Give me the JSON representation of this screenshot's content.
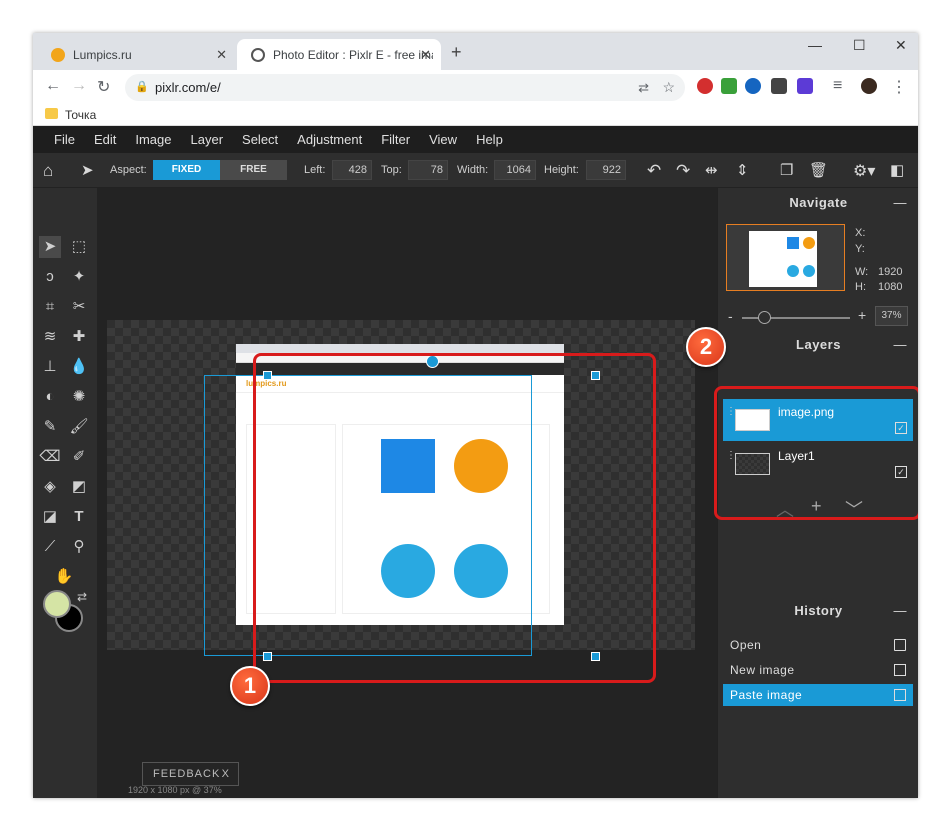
{
  "browser": {
    "tabs": [
      {
        "title": "Lumpics.ru"
      },
      {
        "title": "Photo Editor : Pixlr E - free image"
      }
    ],
    "url": "pixlr.com/e/",
    "bookmark": "Точка"
  },
  "menu": [
    "File",
    "Edit",
    "Image",
    "Layer",
    "Select",
    "Adjustment",
    "Filter",
    "View",
    "Help"
  ],
  "toolbar": {
    "aspect_label": "Aspect:",
    "fixed_label": "FIXED",
    "free_label": "FREE",
    "left_label": "Left:",
    "left_value": "428",
    "top_label": "Top:",
    "top_value": "78",
    "width_label": "Width:",
    "width_value": "1064",
    "height_label": "Height:",
    "height_value": "922"
  },
  "canvas": {
    "doc_logo": "lumpics.ru",
    "feedback_label": "FEEDBACK",
    "feedback_close": "X",
    "status": "1920 x 1080 px @ 37%"
  },
  "navigate": {
    "title": "Navigate",
    "x_label": "X:",
    "y_label": "Y:",
    "w_label": "W:",
    "w_value": "1920",
    "h_label": "H:",
    "h_value": "1080",
    "zoom": "37%",
    "zoom_level": 0.37
  },
  "layers": {
    "title": "Layers",
    "items": [
      {
        "name": "image.png",
        "visible": true
      },
      {
        "name": "Layer1",
        "visible": true
      }
    ]
  },
  "history": {
    "title": "History",
    "items": [
      {
        "label": "Open"
      },
      {
        "label": "New image"
      },
      {
        "label": "Paste image"
      }
    ]
  },
  "badges": [
    "1",
    "2"
  ],
  "colors": {
    "accent": "#1a9ad6",
    "annotation_red": "#d81b1b",
    "foreground_color": "#d5e4a5",
    "background_color": "#000000"
  }
}
